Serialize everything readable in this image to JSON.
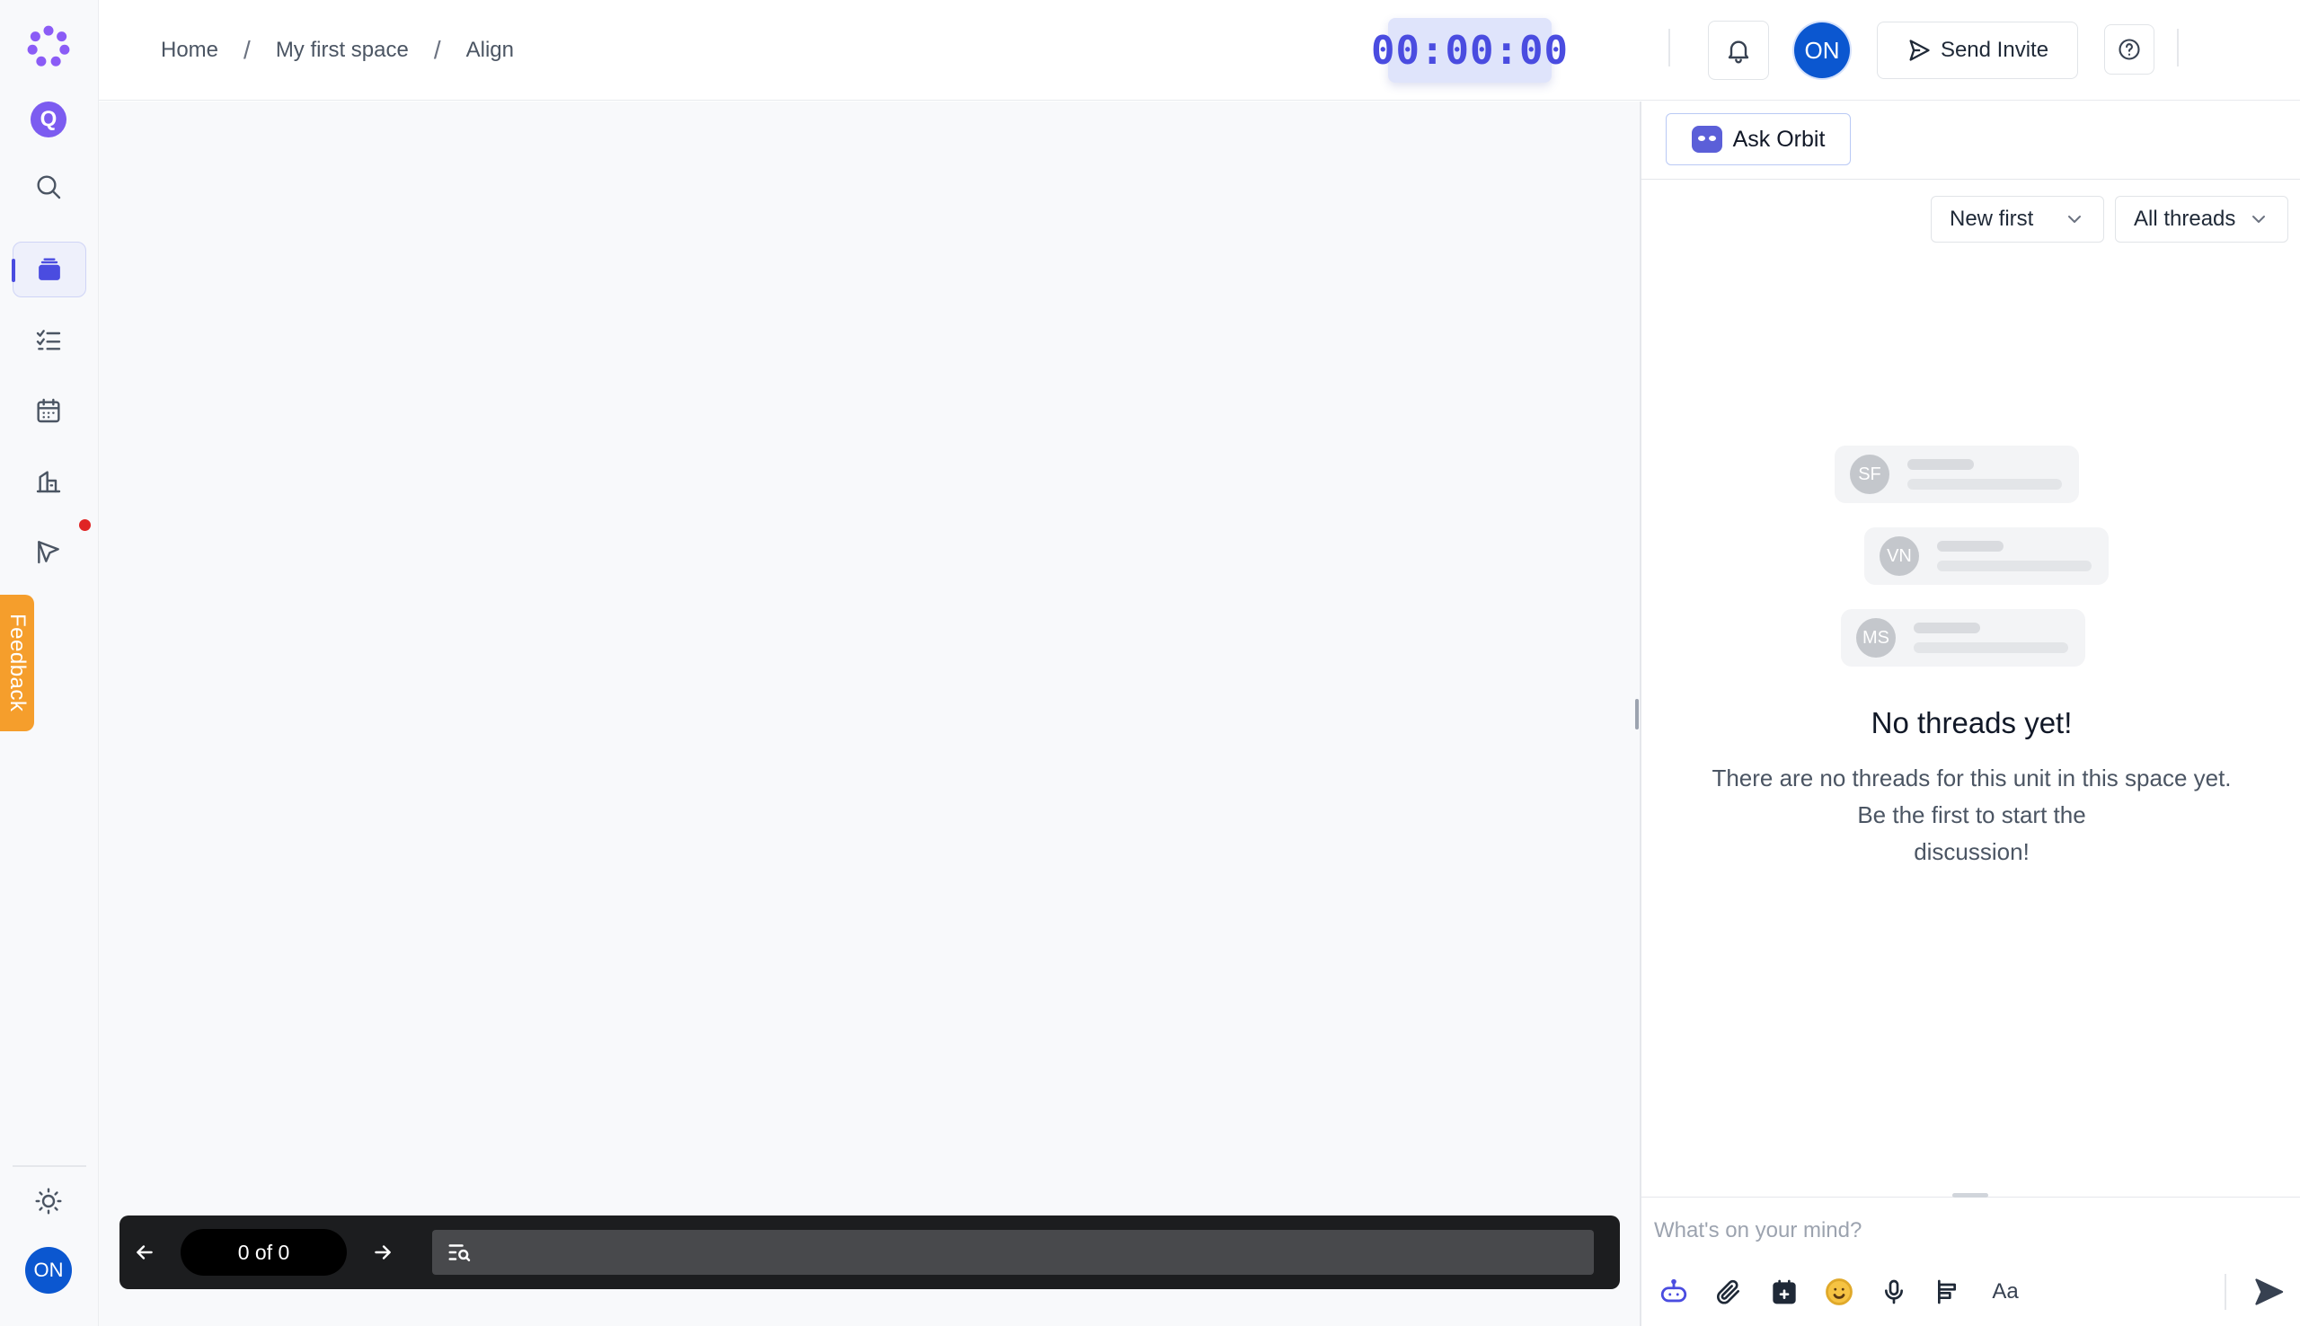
{
  "colors": {
    "accent": "#4a4ce0",
    "avatar_blue": "#0b57d0",
    "feedback_orange": "#f59e2c",
    "notification_red": "#e02424",
    "timer_bg": "#dfe4fb",
    "bottom_bar": "#1c1d1f"
  },
  "rail": {
    "workspace_badge": "Q",
    "user_initials": "ON",
    "feedback_label": "Feedback",
    "icons": [
      "logo-icon",
      "search-icon",
      "spaces-icon",
      "tasks-icon",
      "calendar-icon",
      "analytics-icon",
      "announcements-icon",
      "theme-icon"
    ]
  },
  "breadcrumb": {
    "items": [
      "Home",
      "My first space",
      "Align"
    ],
    "separator": "/"
  },
  "header": {
    "timer": "00:00:00",
    "user_initials": "ON",
    "send_invite_label": "Send Invite"
  },
  "viewer": {
    "pager": "0 of 0",
    "search_placeholder": ""
  },
  "panel": {
    "ask_orbit_label": "Ask Orbit",
    "sort_select": "New first",
    "filter_select": "All threads",
    "placeholders": [
      "SF",
      "VN",
      "MS"
    ],
    "empty_title": "No threads yet!",
    "empty_line1": "There are no threads for this unit in this space yet.",
    "empty_line2": "Be the first to start the",
    "empty_line3": "discussion!",
    "composer_placeholder": "What's on your mind?",
    "text_format_label": "Aa"
  }
}
